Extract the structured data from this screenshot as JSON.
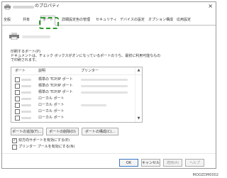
{
  "window": {
    "title": "のプロパティ",
    "close": "×"
  },
  "tabs": [
    {
      "label": "全般"
    },
    {
      "label": "共有"
    },
    {
      "label": "ポート"
    },
    {
      "label": "詳細設定"
    },
    {
      "label": "色の管理"
    },
    {
      "label": "セキュリティ"
    },
    {
      "label": "デバイスの設定"
    },
    {
      "label": "オプション構成"
    },
    {
      "label": "応用設定"
    }
  ],
  "active_tab": "ポート",
  "instructions": {
    "line1": "印刷するポート(P)",
    "line2": "ドキュメントは、チェック ボックスがオンになっているポートのうち、最初に利用可能なもの",
    "line3": "で印刷されます。"
  },
  "port_list": {
    "columns": [
      "ポート",
      "説明",
      "プリンター"
    ],
    "rows": [
      {
        "description": "標準の TCP/IP ポート",
        "checked": false
      },
      {
        "description": "標準の TCP/IP ポート",
        "checked": false
      },
      {
        "description": "標準の TCP/IP ポート",
        "checked": false
      },
      {
        "description": "ローカル ポート",
        "checked": false
      },
      {
        "description": "ローカル ポート",
        "checked": false
      },
      {
        "description": "ローカル ポート",
        "checked": false
      },
      {
        "description": "ローカル ポート",
        "checked": false
      }
    ]
  },
  "port_buttons": {
    "add": "ポートの追加(T)...",
    "delete": "ポートの削除(D)",
    "configure": "ポートの構成(C)..."
  },
  "options": {
    "bidirectional": {
      "label": "双方向サポートを有効にする(E)",
      "checked": true
    },
    "pooling": {
      "label": "プリンター プールを有効にする(N)",
      "checked": false
    }
  },
  "footer": {
    "ok": "OK",
    "cancel": "キャンセル",
    "apply": "適用(A)",
    "help": "ヘルプ"
  },
  "image_code": "MOOZDM0002",
  "colors": {
    "highlight": "#2f9a2f",
    "primary_border": "#3b78c4"
  }
}
